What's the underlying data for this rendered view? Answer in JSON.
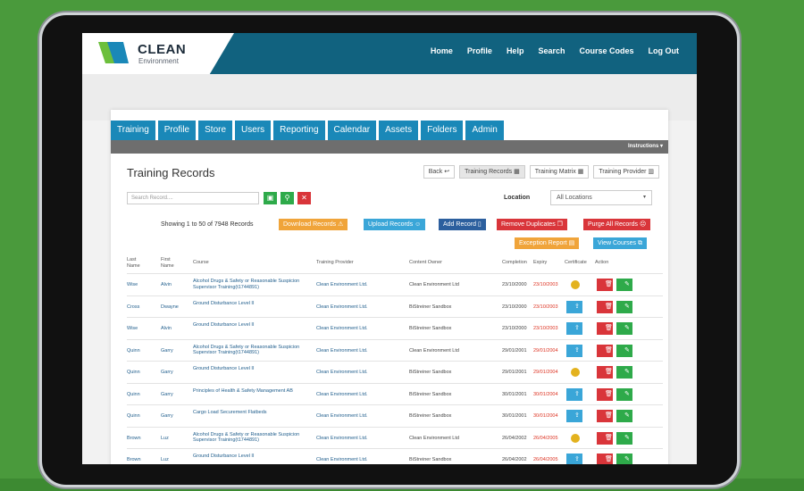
{
  "brand": {
    "name": "CLEAN",
    "sub": "Environment"
  },
  "nav": [
    "Home",
    "Profile",
    "Help",
    "Search",
    "Course Codes",
    "Log Out"
  ],
  "tabs": [
    "Training",
    "Profile",
    "Store",
    "Users",
    "Reporting",
    "Calendar",
    "Assets",
    "Folders",
    "Admin"
  ],
  "instructions": "Instructions",
  "page_title": "Training Records",
  "view_buttons": [
    "Back",
    "Training Records",
    "Training Matrix",
    "Training Provider"
  ],
  "search": {
    "placeholder": "Search Record...."
  },
  "location": {
    "label": "Location",
    "value": "All Locations"
  },
  "showing": "Showing 1 to 50 of 7948 Records",
  "actions": {
    "download": "Download Records",
    "upload": "Upload Records",
    "add": "Add Record",
    "remove_dup": "Remove Duplicates",
    "purge": "Purge All Records",
    "exception": "Exception Report",
    "view_courses": "View Courses"
  },
  "columns": {
    "last": "Last\nName",
    "first": "First\nName",
    "course": "Course",
    "provider": "Training Provider",
    "owner": "Content Owner",
    "completion": "Completion",
    "expiry": "Expiry",
    "certificate": "Certificate",
    "action": "Action"
  },
  "rows": [
    {
      "last": "Wise",
      "first": "Alvin",
      "course": "Alcohol Drugs & Safety or Reasonable Suspicion Supervisor Training(t1744891)",
      "provider": "Clean Environment Ltd.",
      "owner": "Clean Environment Ltd",
      "completion": "23/10/2000",
      "expiry": "23/10/2003",
      "cert": "dot"
    },
    {
      "last": "Cross",
      "first": "Dwayne",
      "course": "Ground Disturbance Level II",
      "provider": "Clean Environment Ltd.",
      "owner": "BiStreiner Sandbox",
      "completion": "23/10/2000",
      "expiry": "23/10/2003",
      "cert": "btn"
    },
    {
      "last": "Wise",
      "first": "Alvin",
      "course": "Ground Disturbance Level II",
      "provider": "Clean Environment Ltd.",
      "owner": "BiStreiner Sandbox",
      "completion": "23/10/2000",
      "expiry": "23/10/2003",
      "cert": "btn"
    },
    {
      "last": "Quinn",
      "first": "Garry",
      "course": "Alcohol Drugs & Safety or Reasonable Suspicion Supervisor Training(t1744891)",
      "provider": "Clean Environment Ltd.",
      "owner": "Clean Environment Ltd",
      "completion": "29/01/2001",
      "expiry": "29/01/2004",
      "cert": "btn"
    },
    {
      "last": "Quinn",
      "first": "Garry",
      "course": "Ground Disturbance Level II",
      "provider": "Clean Environment Ltd.",
      "owner": "BiStreiner Sandbox",
      "completion": "29/01/2001",
      "expiry": "29/01/2004",
      "cert": "dot"
    },
    {
      "last": "Quinn",
      "first": "Garry",
      "course": "Principles of Health & Safety Management AB",
      "provider": "Clean Environment Ltd.",
      "owner": "BiStreiner Sandbox",
      "completion": "30/01/2001",
      "expiry": "30/01/2004",
      "cert": "btn"
    },
    {
      "last": "Quinn",
      "first": "Garry",
      "course": "Cargo Load Securement Flatbeds",
      "provider": "Clean Environment Ltd.",
      "owner": "BiStreiner Sandbox",
      "completion": "30/01/2001",
      "expiry": "30/01/2004",
      "cert": "btn"
    },
    {
      "last": "Brown",
      "first": "Luz",
      "course": "Alcohol Drugs & Safety or Reasonable Suspicion Supervisor Training(t1744891)",
      "provider": "Clean Environment Ltd.",
      "owner": "Clean Environment Ltd",
      "completion": "26/04/2002",
      "expiry": "26/04/2005",
      "cert": "dot"
    },
    {
      "last": "Brown",
      "first": "Luz",
      "course": "Ground Disturbance Level II",
      "provider": "Clean Environment Ltd.",
      "owner": "BiStreiner Sandbox",
      "completion": "26/04/2002",
      "expiry": "26/04/2005",
      "cert": "btn"
    }
  ],
  "colors": {
    "accent": "#1a88b8",
    "topbar": "#11627f",
    "orange": "#f0a43a",
    "red": "#d9353a",
    "green": "#2eaa4a",
    "blue": "#3aa6d8",
    "navy": "#2c5f9e"
  }
}
